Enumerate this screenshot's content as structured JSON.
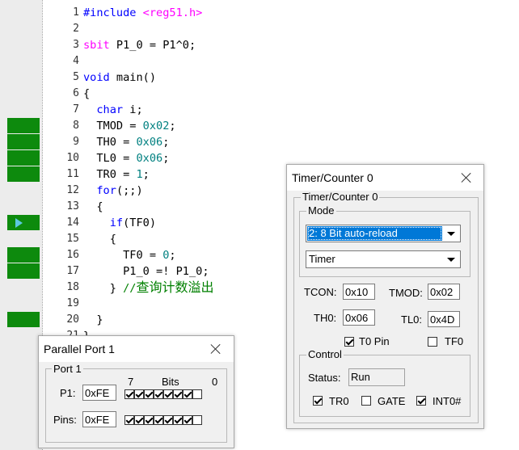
{
  "code_editor": {
    "lines": [
      {
        "num": "1",
        "parts": [
          {
            "t": "#include ",
            "c": "kw"
          },
          {
            "t": "<reg51.h>",
            "c": "mac"
          }
        ],
        "marker": "none"
      },
      {
        "num": "2",
        "parts": [],
        "marker": "none"
      },
      {
        "num": "3",
        "parts": [
          {
            "t": "sbit",
            "c": "mac"
          },
          {
            "t": " P1_0 = P1^0;",
            "c": ""
          }
        ],
        "marker": "none"
      },
      {
        "num": "4",
        "parts": [],
        "marker": "none"
      },
      {
        "num": "5",
        "parts": [
          {
            "t": "void",
            "c": "kw"
          },
          {
            "t": " main()",
            "c": ""
          }
        ],
        "marker": "none"
      },
      {
        "num": "6",
        "parts": [
          {
            "t": "{",
            "c": ""
          }
        ],
        "marker": "none"
      },
      {
        "num": "7",
        "parts": [
          {
            "t": "  ",
            "c": ""
          },
          {
            "t": "char",
            "c": "kw"
          },
          {
            "t": " i;",
            "c": ""
          }
        ],
        "marker": "none"
      },
      {
        "num": "8",
        "parts": [
          {
            "t": "  TMOD = ",
            "c": ""
          },
          {
            "t": "0x02",
            "c": "num"
          },
          {
            "t": ";",
            "c": ""
          }
        ],
        "marker": "green"
      },
      {
        "num": "9",
        "parts": [
          {
            "t": "  TH0 = ",
            "c": ""
          },
          {
            "t": "0x06",
            "c": "num"
          },
          {
            "t": ";",
            "c": ""
          }
        ],
        "marker": "green"
      },
      {
        "num": "10",
        "parts": [
          {
            "t": "  TL0 = ",
            "c": ""
          },
          {
            "t": "0x06",
            "c": "num"
          },
          {
            "t": ";",
            "c": ""
          }
        ],
        "marker": "green"
      },
      {
        "num": "11",
        "parts": [
          {
            "t": "  TR0 = ",
            "c": ""
          },
          {
            "t": "1",
            "c": "num"
          },
          {
            "t": ";",
            "c": ""
          }
        ],
        "marker": "green"
      },
      {
        "num": "12",
        "parts": [
          {
            "t": "  ",
            "c": ""
          },
          {
            "t": "for",
            "c": "kw"
          },
          {
            "t": "(;;)",
            "c": ""
          }
        ],
        "marker": "none"
      },
      {
        "num": "13",
        "parts": [
          {
            "t": "  {",
            "c": ""
          }
        ],
        "marker": "none"
      },
      {
        "num": "14",
        "parts": [
          {
            "t": "    ",
            "c": ""
          },
          {
            "t": "if",
            "c": "kw"
          },
          {
            "t": "(TF0)",
            "c": ""
          }
        ],
        "marker": "arrow"
      },
      {
        "num": "15",
        "parts": [
          {
            "t": "    {",
            "c": ""
          }
        ],
        "marker": "none"
      },
      {
        "num": "16",
        "parts": [
          {
            "t": "      TF0 = ",
            "c": ""
          },
          {
            "t": "0",
            "c": "num"
          },
          {
            "t": ";",
            "c": ""
          }
        ],
        "marker": "green"
      },
      {
        "num": "17",
        "parts": [
          {
            "t": "      P1_0 =! P1_0;",
            "c": ""
          }
        ],
        "marker": "green"
      },
      {
        "num": "18",
        "parts": [
          {
            "t": "    } ",
            "c": ""
          },
          {
            "t": "//",
            "c": "cmt-prefix"
          },
          {
            "t": "查询计数溢出",
            "c": "cmt"
          }
        ],
        "marker": "none"
      },
      {
        "num": "19",
        "parts": [],
        "marker": "none"
      },
      {
        "num": "20",
        "parts": [
          {
            "t": "  }",
            "c": ""
          }
        ],
        "marker": "green"
      },
      {
        "num": "21",
        "parts": [
          {
            "t": "}",
            "c": ""
          }
        ],
        "marker": "none"
      }
    ]
  },
  "parallel_port": {
    "title": "Parallel Port 1",
    "group_label": "Port 1",
    "bit_high": "7",
    "bits_label": "Bits",
    "bit_low": "0",
    "p1_label": "P1:",
    "p1_value": "0xFE",
    "p1_bits": [
      true,
      true,
      true,
      true,
      true,
      true,
      true,
      false
    ],
    "pins_label": "Pins:",
    "pins_value": "0xFE",
    "pins_bits": [
      true,
      true,
      true,
      true,
      true,
      true,
      true,
      false
    ]
  },
  "timer_counter": {
    "title": "Timer/Counter 0",
    "group_label": "Timer/Counter 0",
    "mode_group_label": "Mode",
    "mode_selected": "2: 8 Bit auto-reload",
    "source_selected": "Timer",
    "tcon_label": "TCON:",
    "tcon_value": "0x10",
    "tmod_label": "TMOD:",
    "tmod_value": "0x02",
    "th0_label": "TH0:",
    "th0_value": "0x06",
    "tl0_label": "TL0:",
    "tl0_value": "0x4D",
    "t0pin_label": "T0 Pin",
    "t0pin_checked": true,
    "tf0_label": "TF0",
    "tf0_checked": false,
    "control_group_label": "Control",
    "status_label": "Status:",
    "status_value": "Run",
    "tr0_label": "TR0",
    "tr0_checked": true,
    "gate_label": "GATE",
    "gate_checked": false,
    "int0_label": "INT0#",
    "int0_checked": true
  }
}
